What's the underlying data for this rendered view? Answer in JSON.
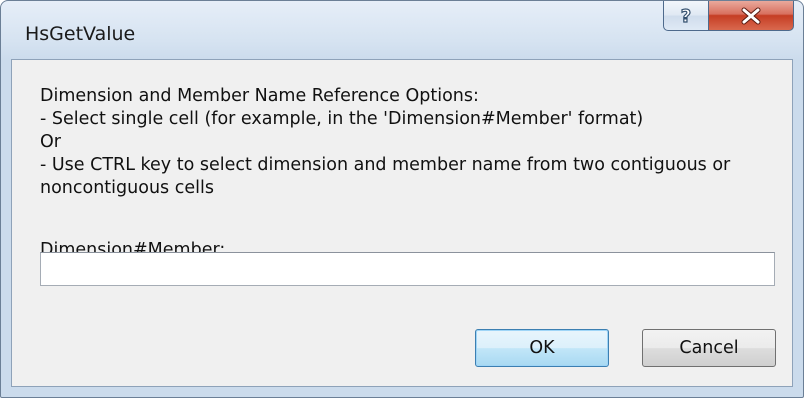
{
  "window": {
    "title": "HsGetValue"
  },
  "titlebar_buttons": {
    "help_icon": "help-icon",
    "close_icon": "close-icon",
    "close_color": "#c53d24"
  },
  "dialog": {
    "description_lines": [
      "Dimension and Member Name Reference Options:",
      "- Select single cell (for example, in the 'Dimension#Member' format)",
      "Or",
      "- Use CTRL key to select dimension and member name from two contiguous or",
      "noncontiguous cells"
    ],
    "field_label": "Dimension#Member:",
    "field_value": "",
    "ok_label": "OK",
    "cancel_label": "Cancel"
  }
}
